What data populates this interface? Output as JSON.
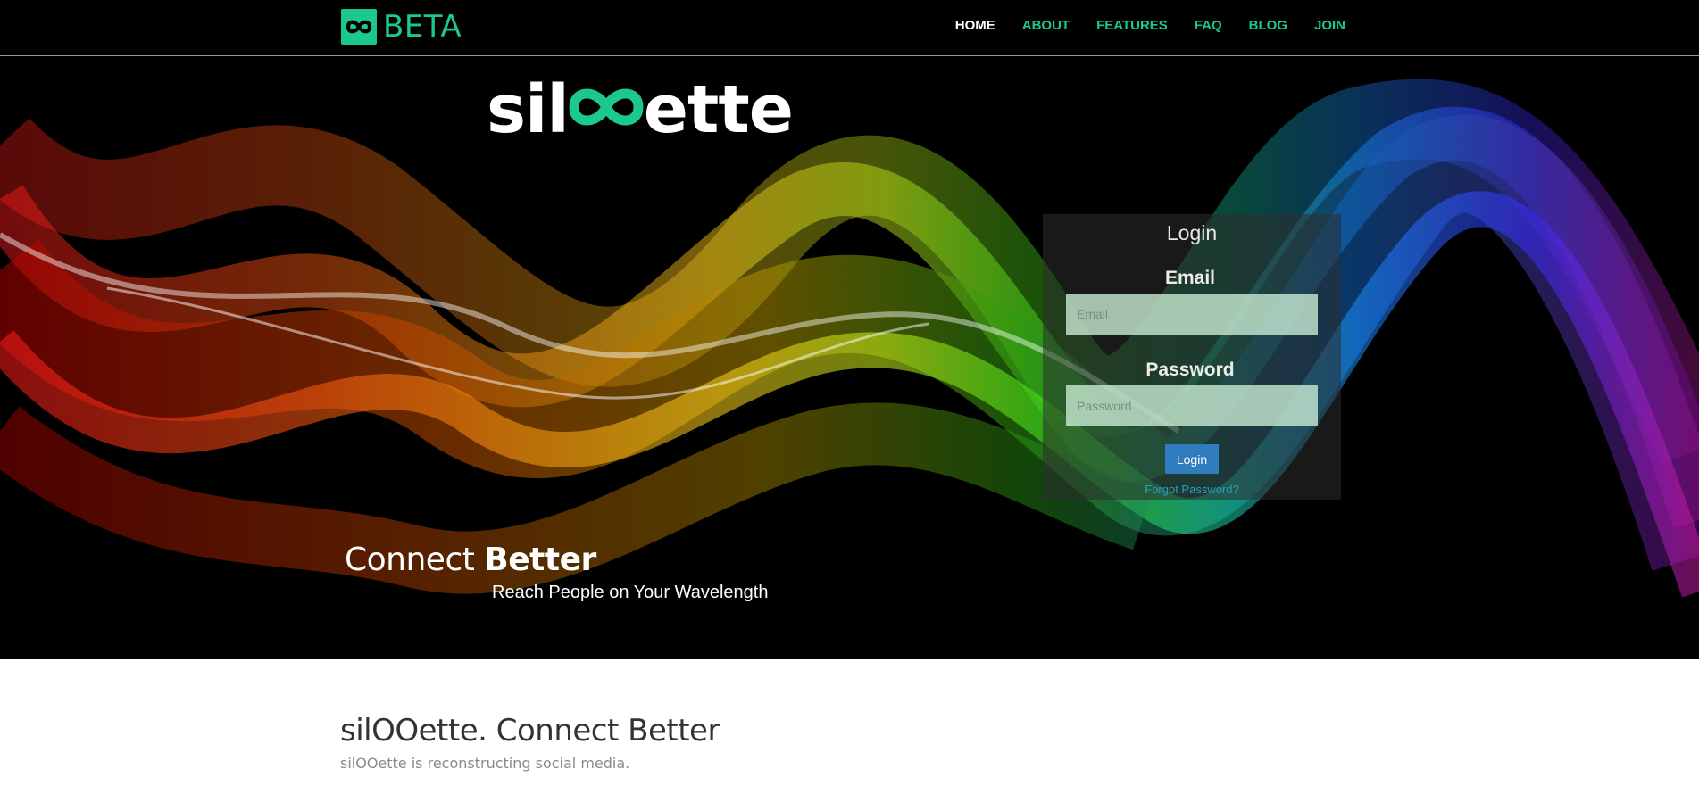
{
  "brand": {
    "icon": "infinity-icon",
    "text": "BETA",
    "color": "#1bc98e"
  },
  "nav": {
    "items": [
      {
        "label": "HOME",
        "active": true
      },
      {
        "label": "ABOUT",
        "active": false
      },
      {
        "label": "FEATURES",
        "active": false
      },
      {
        "label": "FAQ",
        "active": false
      },
      {
        "label": "BLOG",
        "active": false
      },
      {
        "label": "JOIN",
        "active": false
      }
    ],
    "active_color": "#ffffff",
    "link_color": "#1bc98e"
  },
  "hero": {
    "logo_prefix": "sil",
    "logo_mark": "infinity-icon",
    "logo_suffix": "ette",
    "tagline_regular": "Connect ",
    "tagline_bold": "Better",
    "subtagline": "Reach People on Your Wavelength",
    "background": "rainbow-wave-image"
  },
  "login": {
    "title": "Login",
    "email_label": "Email",
    "email_placeholder": "Email",
    "email_value": "",
    "password_label": "Password",
    "password_placeholder": "Password",
    "password_value": "",
    "button_label": "Login",
    "forgot_label": "Forgot Password?",
    "button_color": "#2f7dbf"
  },
  "content": {
    "title": "silOOette. Connect Better",
    "text": "silOOette is reconstructing social media."
  }
}
